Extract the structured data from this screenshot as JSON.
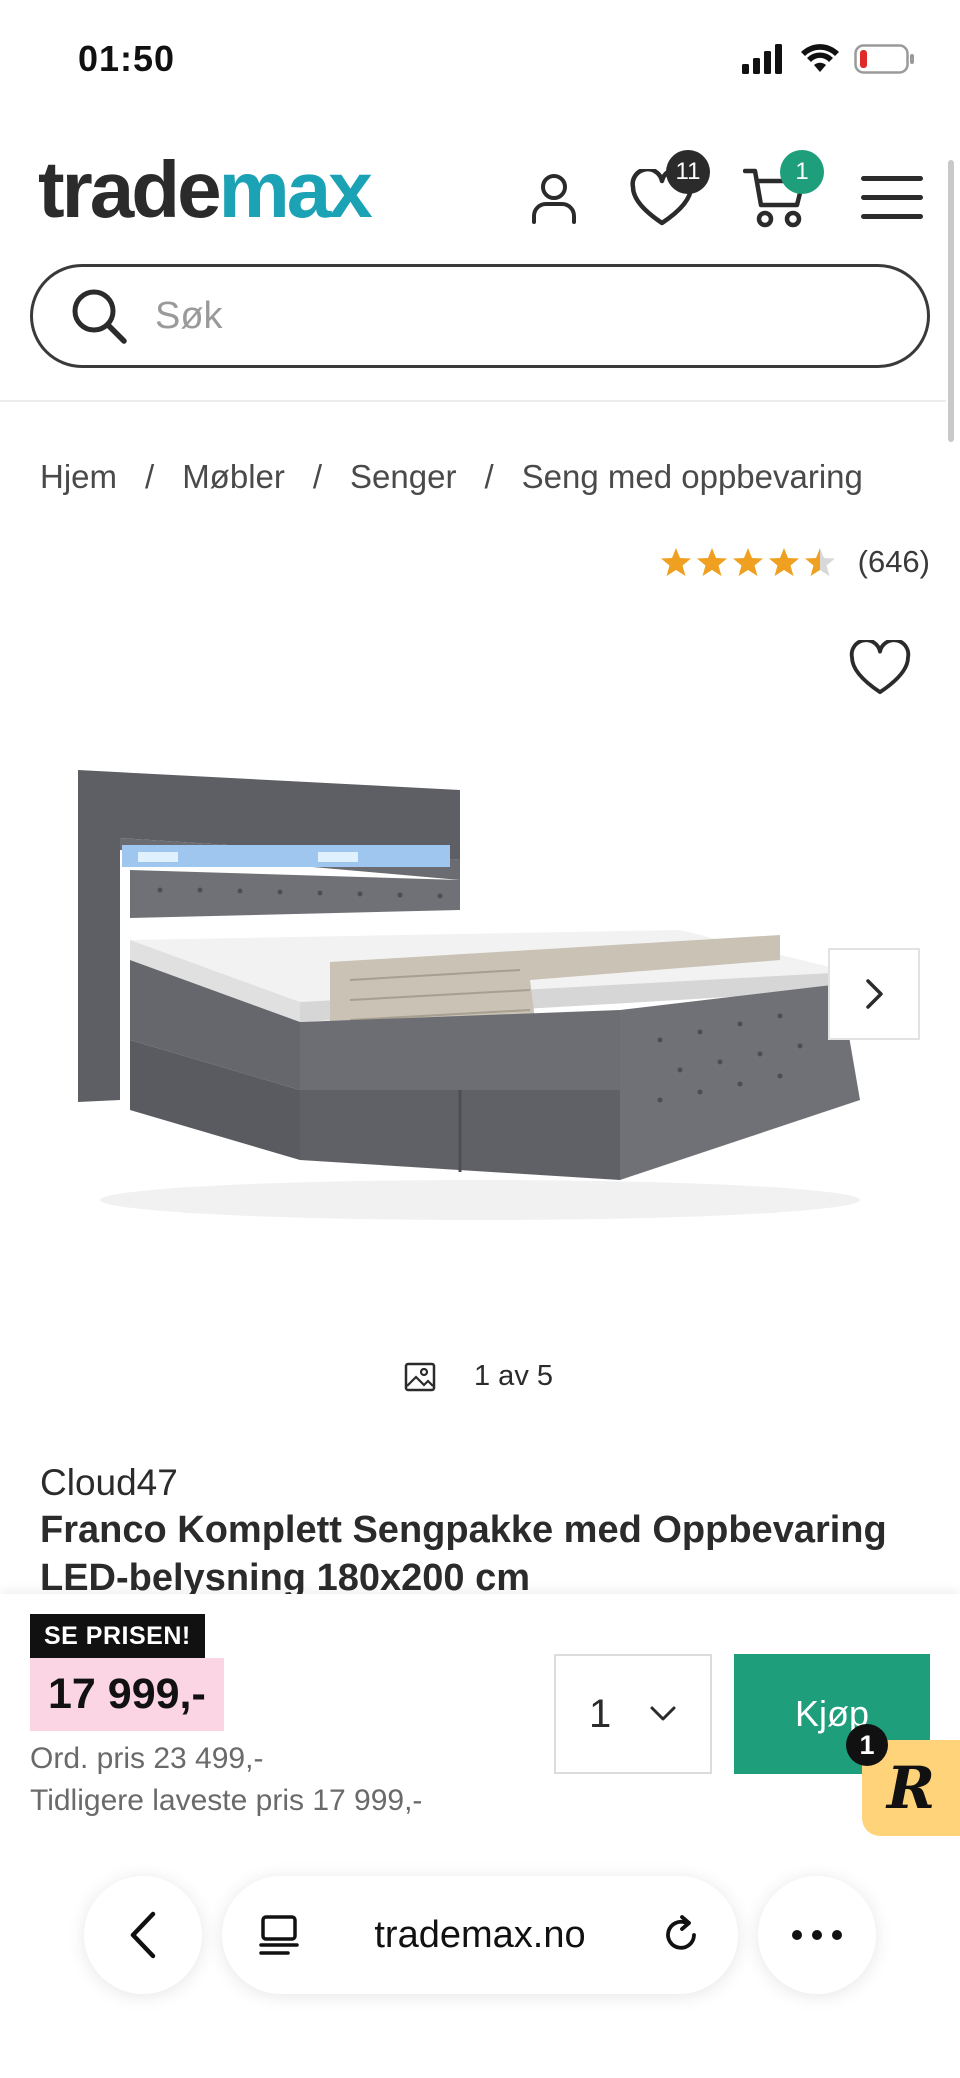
{
  "status_bar": {
    "time": "01:50",
    "icons": [
      "signal-icon",
      "wifi-icon",
      "battery-low-icon"
    ]
  },
  "header": {
    "logo_part1": "trade",
    "logo_part2": "max",
    "wishlist_count": "11",
    "cart_count": "1",
    "icons": [
      "account-icon",
      "heart-icon",
      "cart-icon",
      "menu-icon"
    ]
  },
  "search": {
    "placeholder": "Søk"
  },
  "breadcrumb": {
    "items": [
      "Hjem",
      "Møbler",
      "Senger",
      "Seng med oppbevaring"
    ],
    "separator": "/"
  },
  "rating": {
    "stars": "★★★★★",
    "value": 4.5,
    "count": "(646)"
  },
  "gallery": {
    "counter": "1 av 5"
  },
  "product": {
    "brand": "Cloud47",
    "title": "Franco Komplett Sengpakke med Oppbevaring LED-belysning 180x200 cm"
  },
  "pricing": {
    "promo_label": "SE PRISEN!",
    "price": "17 999,-",
    "ordinary_price": "Ord. pris 23 499,-",
    "lowest_price": "Tidligere laveste pris 17 999,-"
  },
  "purchase": {
    "quantity": "1",
    "buy_label": "Kjøp"
  },
  "chat_widget": {
    "badge": "1",
    "letter": "R"
  },
  "browser": {
    "url": "trademax.no"
  },
  "colors": {
    "brand_teal": "#1ba2b5",
    "buy_green": "#1e9e7b",
    "price_highlight": "#fbd5e4",
    "star": "#f0a020"
  }
}
